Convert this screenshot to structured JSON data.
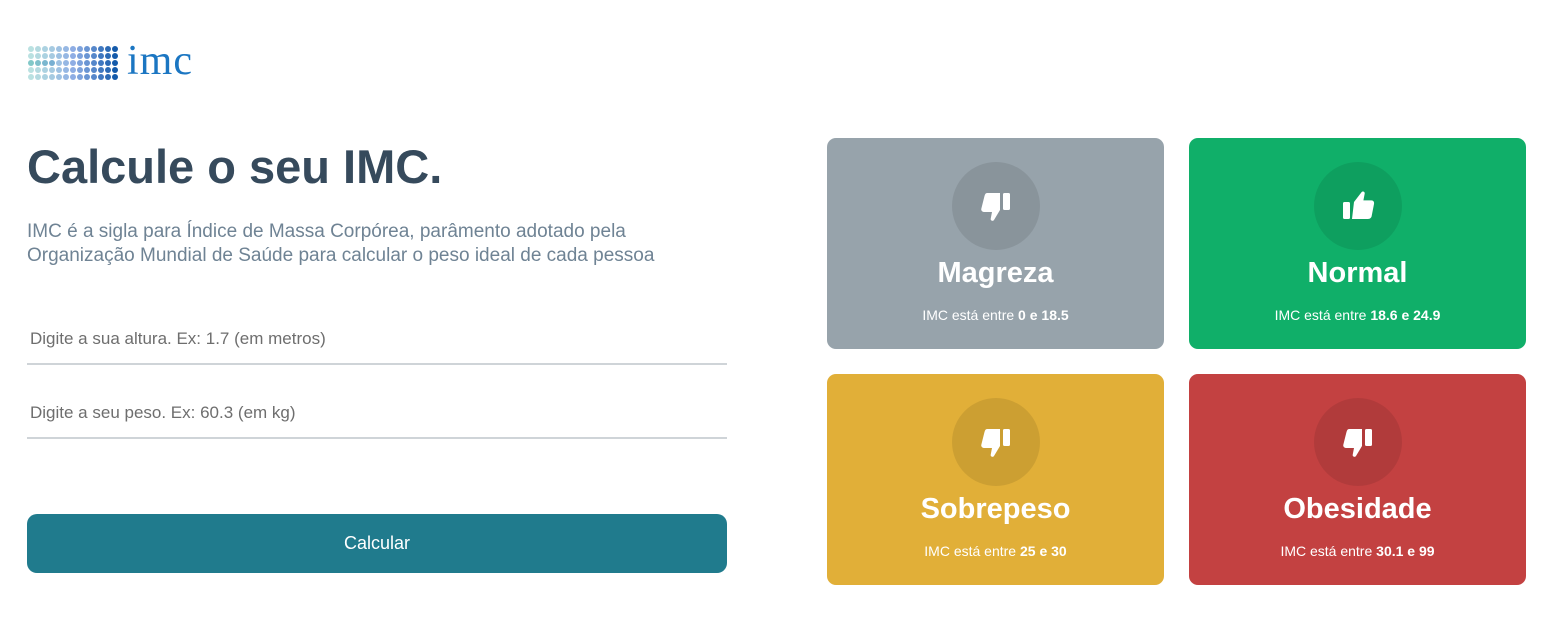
{
  "logo": {
    "text": "imc",
    "icon": "dot-grid-logo-icon"
  },
  "header": {
    "title": "Calcule o seu IMC.",
    "description": "IMC é a sigla para Índice de Massa Corpórea, parâmento adotado pela Organização Mundial de Saúde para calcular o peso ideal de cada pessoa"
  },
  "form": {
    "altura": {
      "placeholder": "Digite a sua altura. Ex: 1.7 (em metros)",
      "value": ""
    },
    "peso": {
      "placeholder": "Digite a seu peso. Ex: 60.3 (em kg)",
      "value": ""
    },
    "submit_label": "Calcular"
  },
  "cards": [
    {
      "id": "magreza",
      "title": "Magreza",
      "prefix": "IMC está entre",
      "min": "0",
      "sep": "e",
      "max": "18.5",
      "icon": "thumbs-down-icon",
      "color": "#97a3ab"
    },
    {
      "id": "normal",
      "title": "Normal",
      "prefix": "IMC está entre",
      "min": "18.6",
      "sep": "e",
      "max": "24.9",
      "icon": "thumbs-up-icon",
      "color": "#10af69"
    },
    {
      "id": "sobrepeso",
      "title": "Sobrepeso",
      "prefix": "IMC está entre",
      "min": "25",
      "sep": "e",
      "max": "30",
      "icon": "thumbs-down-icon",
      "color": "#e1af38"
    },
    {
      "id": "obesidade",
      "title": "Obesidade",
      "prefix": "IMC está entre",
      "min": "30.1",
      "sep": "e",
      "max": "99",
      "icon": "thumbs-down-icon",
      "color": "#c34141"
    }
  ],
  "colors": {
    "title": "#364a5c",
    "text": "#6f8394",
    "button": "#207b8d",
    "logo": "#1b76c2"
  }
}
